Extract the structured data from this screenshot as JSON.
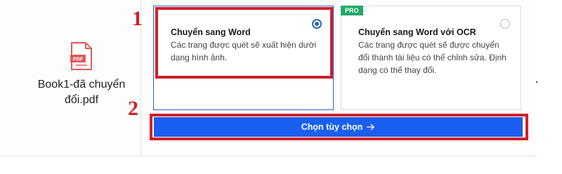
{
  "file": {
    "icon": "pdf-file-icon",
    "badge": "PDF",
    "name": "Book1-đã chuyển đổi.pdf",
    "icon_color": "#e05a5a"
  },
  "options": [
    {
      "title": "Chuyển sang Word",
      "description": "Các trang được quét sẽ xuất hiện dưới dạng hình ảnh.",
      "selected": true
    },
    {
      "badge": "PRO",
      "title": "Chuyển sang Word với OCR",
      "description": "Các trang được quét sẽ được chuyển đổi thành tài liệu có thể chỉnh sửa. Định dạng có thể thay đổi.",
      "selected": false
    }
  ],
  "action": {
    "label": "Chọn tùy chọn",
    "icon": "arrow-right-icon"
  },
  "annotations": {
    "step1": "1",
    "step2": "2",
    "color": "#d21f2b"
  },
  "colors": {
    "accent": "#1a5ff0",
    "pro_badge": "#24a96a"
  }
}
